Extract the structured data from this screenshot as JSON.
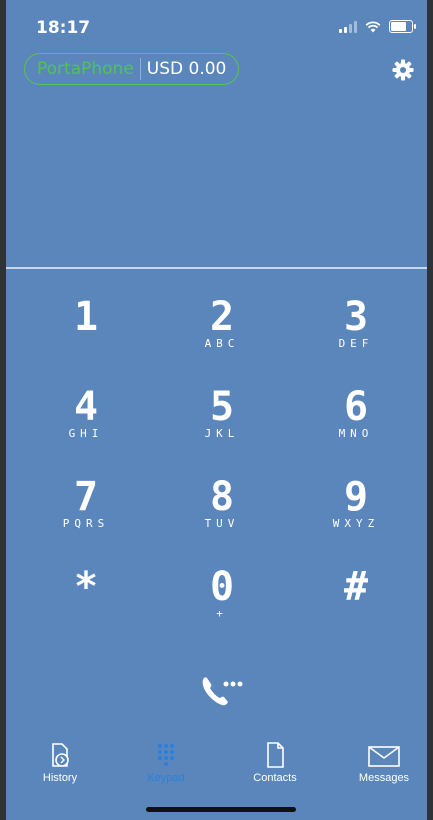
{
  "status_bar": {
    "time": "18:17"
  },
  "header": {
    "brand": "PortaPhone",
    "balance": "USD 0.00"
  },
  "keypad": [
    {
      "digit": "1",
      "letters": ""
    },
    {
      "digit": "2",
      "letters": "ABC"
    },
    {
      "digit": "3",
      "letters": "DEF"
    },
    {
      "digit": "4",
      "letters": "GHI"
    },
    {
      "digit": "5",
      "letters": "JKL"
    },
    {
      "digit": "6",
      "letters": "MNO"
    },
    {
      "digit": "7",
      "letters": "PQRS"
    },
    {
      "digit": "8",
      "letters": "TUV"
    },
    {
      "digit": "9",
      "letters": "WXYZ"
    },
    {
      "digit": "*",
      "letters": ""
    },
    {
      "digit": "0",
      "letters": "+"
    },
    {
      "digit": "#",
      "letters": ""
    }
  ],
  "tabs": [
    {
      "label": "History",
      "icon": "history-icon"
    },
    {
      "label": "Keypad",
      "icon": "keypad-icon",
      "active": true
    },
    {
      "label": "Contacts",
      "icon": "contacts-icon"
    },
    {
      "label": "Messages",
      "icon": "messages-icon"
    }
  ],
  "colors": {
    "background": "#5a86bb",
    "brand_green": "#4fc455",
    "active_tab": "#2a7fe0"
  }
}
